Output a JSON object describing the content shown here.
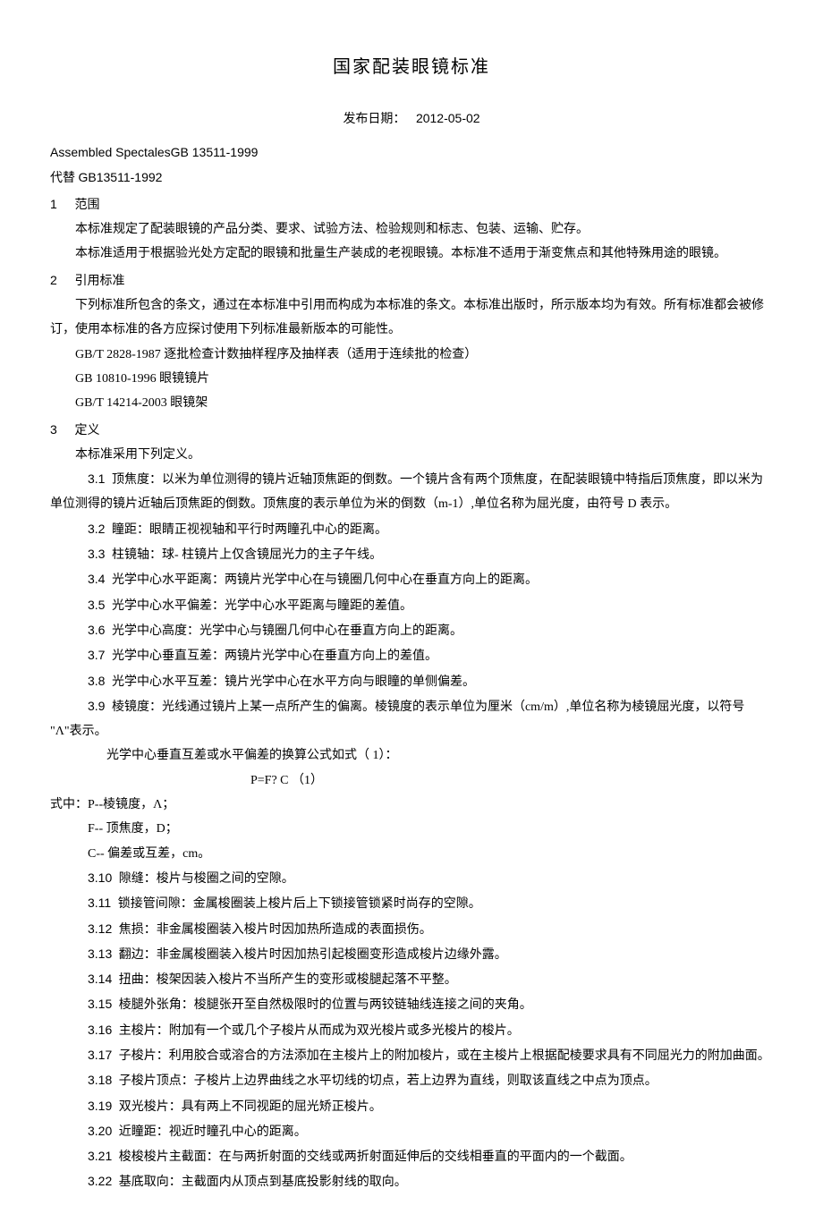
{
  "title": "国家配装眼镜标准",
  "pubdate_label": "发布日期：",
  "pubdate_value": "2012-05-02",
  "en_line": "Assembled SpectalesGB 13511-1999",
  "supersedes_label": "代替 ",
  "supersedes_code": "GB13511-1992",
  "sec1": {
    "num": "1",
    "title": "范围",
    "p1": "本标准规定了配装眼镜的产品分类、要求、试验方法、检验规则和标志、包装、运输、贮存。",
    "p2": "本标准适用于根据验光处方定配的眼镜和批量生产装成的老视眼镜。本标准不适用于渐变焦点和其他特殊用途的眼镜。"
  },
  "sec2": {
    "num": "2",
    "title": "引用标准",
    "p1": "下列标准所包含的条文，通过在本标准中引用而构成为本标准的条文。本标准出版时，所示版本均为有效。所有标准都会被修订，使用本标准的各方应探讨使用下列标准最新版本的可能性。",
    "r1": "GB/T 2828-1987 逐批检查计数抽样程序及抽样表（适用于连续批的检查）",
    "r2": "GB 10810-1996 眼镜镜片",
    "r3": "GB/T 14214-2003 眼镜架"
  },
  "sec3": {
    "num": "3",
    "title": "定义",
    "intro": "本标准采用下列定义。",
    "d3_1_num": "3.1",
    "d3_1": " 顶焦度：以米为单位测得的镜片近轴顶焦距的倒数。一个镜片含有两个顶焦度，在配装眼镜中特指后顶焦度，即以米为单位测得的镜片近轴后顶焦距的倒数。顶焦度的表示单位为米的倒数（m-1）,单位名称为屈光度，由符号 D 表示。",
    "d3_2_num": "3.2",
    "d3_2": " 瞳距：眼睛正视视轴和平行时两瞳孔中心的距离。",
    "d3_3_num": "3.3",
    "d3_3": " 柱镜轴：球- 柱镜片上仅含镜屈光力的主子午线。",
    "d3_4_num": "3.4",
    "d3_4": " 光学中心水平距离：两镜片光学中心在与镜圈几何中心在垂直方向上的距离。",
    "d3_5_num": "3.5",
    "d3_5": " 光学中心水平偏差：光学中心水平距离与瞳距的差值。",
    "d3_6_num": "3.6",
    "d3_6": " 光学中心高度：光学中心与镜圈几何中心在垂直方向上的距离。",
    "d3_7_num": "3.7",
    "d3_7": " 光学中心垂直互差：两镜片光学中心在垂直方向上的差值。",
    "d3_8_num": "3.8",
    "d3_8": " 光学中心水平互差：镜片光学中心在水平方向与眼瞳的单侧偏差。",
    "d3_9_num": "3.9",
    "d3_9": " 棱镜度：光线通过镜片上某一点所产生的偏离。棱镜度的表示单位为厘米（cm/m）,单位名称为棱镜屈光度，以符号 \"Λ\"表示。",
    "formula_intro": "光学中心垂直互差或水平偏差的换算公式如式（ 1）：",
    "formula": "P=F? C （1）",
    "where_intro": "式中：P--棱镜度，Λ；",
    "where_f": "F-- 顶焦度，D；",
    "where_c": "C-- 偏差或互差，cm。",
    "d3_10_num": "3.10",
    "d3_10": " 隙缝：梭片与梭圈之间的空隙。",
    "d3_11_num": "3.11",
    "d3_11": " 锁接管间隙：金属梭圈装上梭片后上下锁接管锁紧时尚存的空隙。",
    "d3_12_num": "3.12",
    "d3_12": " 焦损：非金属梭圈装入梭片时因加热所造成的表面损伤。",
    "d3_13_num": "3.13",
    "d3_13": " 翻边：非金属梭圈装入梭片时因加热引起梭圈变形造成梭片边缘外露。",
    "d3_14_num": "3.14",
    "d3_14": " 扭曲：梭架因装入梭片不当所产生的变形或梭腿起落不平整。",
    "d3_15_num": "3.15",
    "d3_15": " 棱腿外张角：梭腿张开至自然极限时的位置与两铰链轴线连接之间的夹角。",
    "d3_16_num": "3.16",
    "d3_16": " 主梭片：附加有一个或几个子梭片从而成为双光梭片或多光梭片的梭片。",
    "d3_17_num": "3.17",
    "d3_17": " 子梭片：利用胶合或溶合的方法添加在主梭片上的附加梭片，或在主梭片上根据配棱要求具有不同屈光力的附加曲面。",
    "d3_18_num": "3.18",
    "d3_18": " 子梭片顶点：子梭片上边界曲线之水平切线的切点，若上边界为直线，则取该直线之中点为顶点。",
    "d3_19_num": "3.19",
    "d3_19": " 双光梭片：具有两上不同视距的屈光矫正梭片。",
    "d3_20_num": "3.20",
    "d3_20": " 近瞳距：视近时瞳孔中心的距离。",
    "d3_21_num": "3.21",
    "d3_21": " 梭梭梭片主截面：在与两折射面的交线或两折射面延伸后的交线相垂直的平面内的一个截面。",
    "d3_22_num": "3.22",
    "d3_22": " 基底取向：主截面内从顶点到基底投影射线的取向。"
  }
}
